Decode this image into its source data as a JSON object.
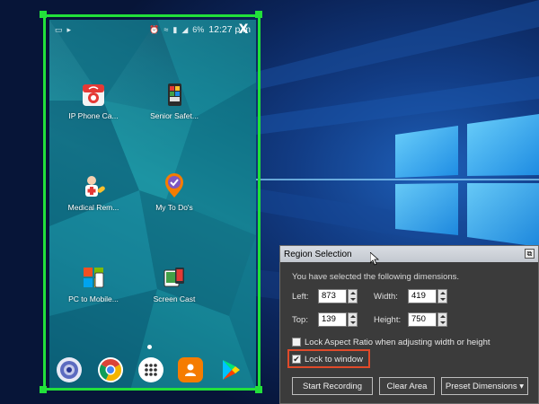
{
  "phone": {
    "status_time": "12:27 p.m",
    "status_battery": "6%",
    "close_label": "X",
    "apps": [
      {
        "label": "IP Phone Ca...",
        "icon": "ip-phone-camera-icon"
      },
      {
        "label": "Senior Safet...",
        "icon": "senior-safety-icon"
      },
      {
        "label": "Medical Rem...",
        "icon": "medical-reminder-icon"
      },
      {
        "label": "My To Do's",
        "icon": "todo-icon"
      },
      {
        "label": "PC to Mobile...",
        "icon": "pc-to-mobile-icon"
      },
      {
        "label": "Screen Cast",
        "icon": "screen-cast-icon"
      }
    ],
    "dock": [
      "camera-icon",
      "chrome-icon",
      "app-drawer-icon",
      "contacts-icon",
      "play-store-icon"
    ]
  },
  "dialog": {
    "title": "Region Selection",
    "description": "You have selected the following dimensions.",
    "left_label": "Left:",
    "left_value": "873",
    "width_label": "Width:",
    "width_value": "419",
    "top_label": "Top:",
    "top_value": "139",
    "height_label": "Height:",
    "height_value": "750",
    "lock_aspect_label": "Lock Aspect Ratio when adjusting width or height",
    "lock_aspect_checked": false,
    "lock_window_label": "Lock to window",
    "lock_window_checked": true,
    "start_recording_label": "Start Recording",
    "clear_area_label": "Clear Area",
    "preset_label": "Preset Dimensions ▾"
  },
  "colors": {
    "selection_frame": "#22e03a",
    "highlight": "#e04a2a"
  }
}
